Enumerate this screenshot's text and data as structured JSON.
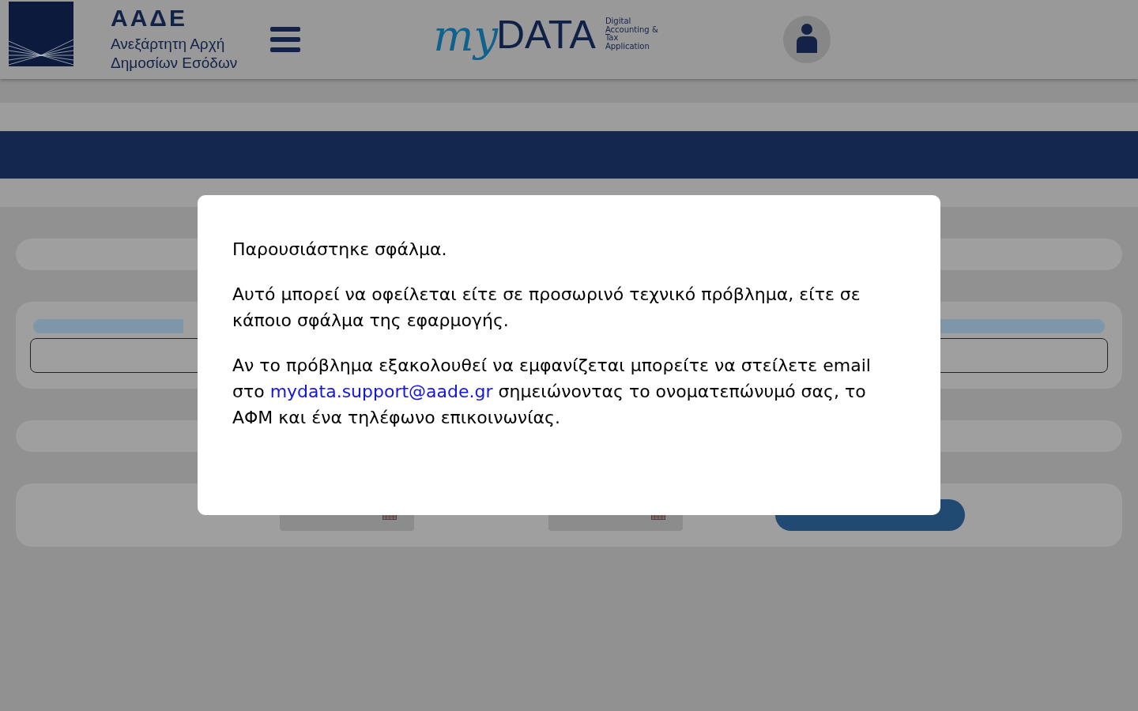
{
  "header": {
    "agency_logo": {
      "abbreviation": "ΑΑΔΕ",
      "name_lines": [
        "Ανεξάρτητη Αρχή",
        "Δημοσίων Εσόδων"
      ]
    },
    "app_logo": {
      "script": "my",
      "word": "DATA",
      "tagline_lines": [
        "Digital",
        "Accounting &",
        "Tax",
        "Application"
      ]
    }
  },
  "error_dialog": {
    "title": "Παρουσιάστηκε σφάλμα.",
    "message": "Αυτό μπορεί να οφείλεται είτε σε προσωρινό τεχνικό πρόβλημα, είτε σε κάποιο σφάλμα της εφαρμογής.",
    "contact": {
      "before": "Αν το πρόβλημα εξακολουθεί να εμφανίζεται μπορείτε να στείλετε email στο",
      "link": "mydata.support@aade.gr",
      "after": "σημειώνοντας το ονοματεπώνυμό σας, το ΑΦΜ και ένα τηλέφωνο επικοινωνίας."
    }
  }
}
